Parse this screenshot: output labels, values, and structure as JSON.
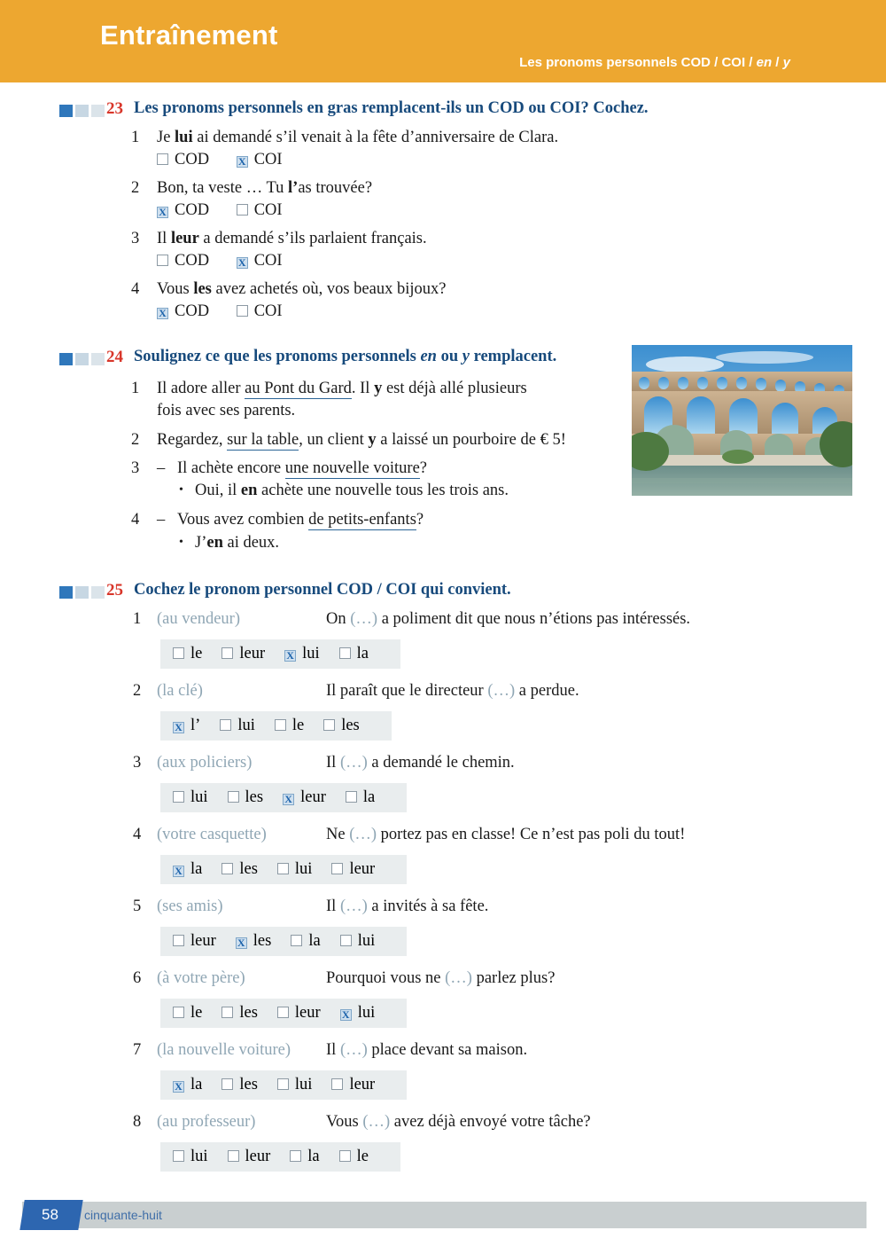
{
  "header": {
    "title": "Entraînement",
    "subtitle_plain_1": "Les pronoms personnels COD / COI / ",
    "subtitle_italic_1": "en",
    "subtitle_plain_2": " / ",
    "subtitle_italic_2": "y",
    "bg_color": "#eda730",
    "text_color": "#ffffff"
  },
  "colors": {
    "exercise_number": "#d8362a",
    "exercise_title": "#174a7c",
    "difficulty_filled": "#2f77bb",
    "difficulty_empty": "#dbe4ea",
    "checkbox_checked_fill": "#cfe0ef",
    "checkbox_mark": "#1c63ab",
    "underline": "#2a6496",
    "option_strip_bg": "#e9edee",
    "cue_text": "#8fa6b4",
    "footer_tab": "#2d66b0",
    "footer_bar": "#c9cfd0"
  },
  "exercise23": {
    "number": "23",
    "title": "Les pronoms personnels en gras remplacent-ils un COD ou COI? Cochez.",
    "difficulty": 1,
    "items": [
      {
        "num": "1",
        "pre": "Je ",
        "bold": "lui",
        "post": " ai demandé s’il venait à la fête d’anniversaire de Clara.",
        "options": [
          {
            "label": "COD",
            "checked": false
          },
          {
            "label": "COI",
            "checked": true
          }
        ]
      },
      {
        "num": "2",
        "pre": "Bon, ta veste … Tu ",
        "bold": "l’",
        "post": "as trouvée?",
        "options": [
          {
            "label": "COD",
            "checked": true
          },
          {
            "label": "COI",
            "checked": false
          }
        ]
      },
      {
        "num": "3",
        "pre": "Il ",
        "bold": "leur",
        "post": " a demandé s’ils parlaient français.",
        "options": [
          {
            "label": "COD",
            "checked": false
          },
          {
            "label": "COI",
            "checked": true
          }
        ]
      },
      {
        "num": "4",
        "pre": "Vous ",
        "bold": "les",
        "post": " avez achetés où, vos beaux bijoux?",
        "options": [
          {
            "label": "COD",
            "checked": true
          },
          {
            "label": "COI",
            "checked": false
          }
        ]
      }
    ]
  },
  "exercise24": {
    "number": "24",
    "title_plain_1": "Soulignez ce que les pronoms personnels ",
    "title_italic_1": "en",
    "title_plain_2": " ou ",
    "title_italic_2": "y",
    "title_plain_3": " remplacent.",
    "difficulty": 1,
    "item1_num": "1",
    "item1_line1_a": "Il adore aller ",
    "item1_line1_underline": "au Pont du Gard",
    "item1_line1_b": ". Il ",
    "item1_line1_bold": "y",
    "item1_line1_c": " est déjà allé plusieurs",
    "item1_line2": "fois avec ses parents.",
    "item2_num": "2",
    "item2_a": "Regardez, ",
    "item2_underline": "sur la table",
    "item2_b": ", un client ",
    "item2_bold": "y",
    "item2_c": " a laissé un pourboire de € 5!",
    "item3_num": "3",
    "item3_dash": "–",
    "item3_a": "Il achète encore ",
    "item3_underline": "une nouvelle voiture",
    "item3_b": "?",
    "item3_bullet": "•",
    "item3_ans_a": "Oui, il ",
    "item3_ans_bold": "en",
    "item3_ans_b": " achète une nouvelle tous les trois ans.",
    "item4_num": "4",
    "item4_dash": "–",
    "item4_a": "Vous avez combien ",
    "item4_underline": "de petits-enfants",
    "item4_b": "?",
    "item4_bullet": "•",
    "item4_ans_a": "J’",
    "item4_ans_bold": "en",
    "item4_ans_b": " ai deux.",
    "photo_alt": "pont-du-gard-photo"
  },
  "exercise25": {
    "number": "25",
    "title": "Cochez le pronom personnel COD / COI qui convient.",
    "difficulty": 1,
    "gap_marker": "(…)",
    "items": [
      {
        "num": "1",
        "cue": "(au vendeur)",
        "sentence_pre": "On ",
        "sentence_post": " a poliment dit que nous n’étions pas intéressés.",
        "options": [
          {
            "label": "le",
            "checked": false
          },
          {
            "label": "leur",
            "checked": false
          },
          {
            "label": "lui",
            "checked": true
          },
          {
            "label": "la",
            "checked": false
          }
        ]
      },
      {
        "num": "2",
        "cue": "(la clé)",
        "sentence_pre": "Il paraît que le directeur ",
        "sentence_post": " a perdue.",
        "options": [
          {
            "label": "l’",
            "checked": true
          },
          {
            "label": "lui",
            "checked": false
          },
          {
            "label": "le",
            "checked": false
          },
          {
            "label": "les",
            "checked": false
          }
        ]
      },
      {
        "num": "3",
        "cue": "(aux policiers)",
        "sentence_pre": "Il ",
        "sentence_post": " a demandé le chemin.",
        "options": [
          {
            "label": "lui",
            "checked": false
          },
          {
            "label": "les",
            "checked": false
          },
          {
            "label": "leur",
            "checked": true
          },
          {
            "label": "la",
            "checked": false
          }
        ]
      },
      {
        "num": "4",
        "cue": "(votre casquette)",
        "sentence_pre": "Ne ",
        "sentence_post": " portez pas en classe! Ce n’est pas poli du tout!",
        "options": [
          {
            "label": "la",
            "checked": true
          },
          {
            "label": "les",
            "checked": false
          },
          {
            "label": "lui",
            "checked": false
          },
          {
            "label": "leur",
            "checked": false
          }
        ]
      },
      {
        "num": "5",
        "cue": "(ses amis)",
        "sentence_pre": "Il ",
        "sentence_post": " a invités à sa fête.",
        "options": [
          {
            "label": "leur",
            "checked": false
          },
          {
            "label": "les",
            "checked": true
          },
          {
            "label": "la",
            "checked": false
          },
          {
            "label": "lui",
            "checked": false
          }
        ]
      },
      {
        "num": "6",
        "cue": "(à votre père)",
        "sentence_pre": "Pourquoi vous ne ",
        "sentence_post": " parlez plus?",
        "options": [
          {
            "label": "le",
            "checked": false
          },
          {
            "label": "les",
            "checked": false
          },
          {
            "label": "leur",
            "checked": false
          },
          {
            "label": "lui",
            "checked": true
          }
        ]
      },
      {
        "num": "7",
        "cue": "(la nouvelle voiture)",
        "sentence_pre": "Il ",
        "sentence_post": " place devant sa maison.",
        "options": [
          {
            "label": "la",
            "checked": true
          },
          {
            "label": "les",
            "checked": false
          },
          {
            "label": "lui",
            "checked": false
          },
          {
            "label": "leur",
            "checked": false
          }
        ]
      },
      {
        "num": "8",
        "cue": "(au professeur)",
        "sentence_pre": "Vous ",
        "sentence_post": " avez déjà envoyé votre tâche?",
        "options": [
          {
            "label": "lui",
            "checked": false
          },
          {
            "label": "leur",
            "checked": false
          },
          {
            "label": "la",
            "checked": false
          },
          {
            "label": "le",
            "checked": false
          }
        ]
      }
    ]
  },
  "footer": {
    "page_number": "58",
    "page_word": "cinquante-huit"
  },
  "check_mark": "X"
}
